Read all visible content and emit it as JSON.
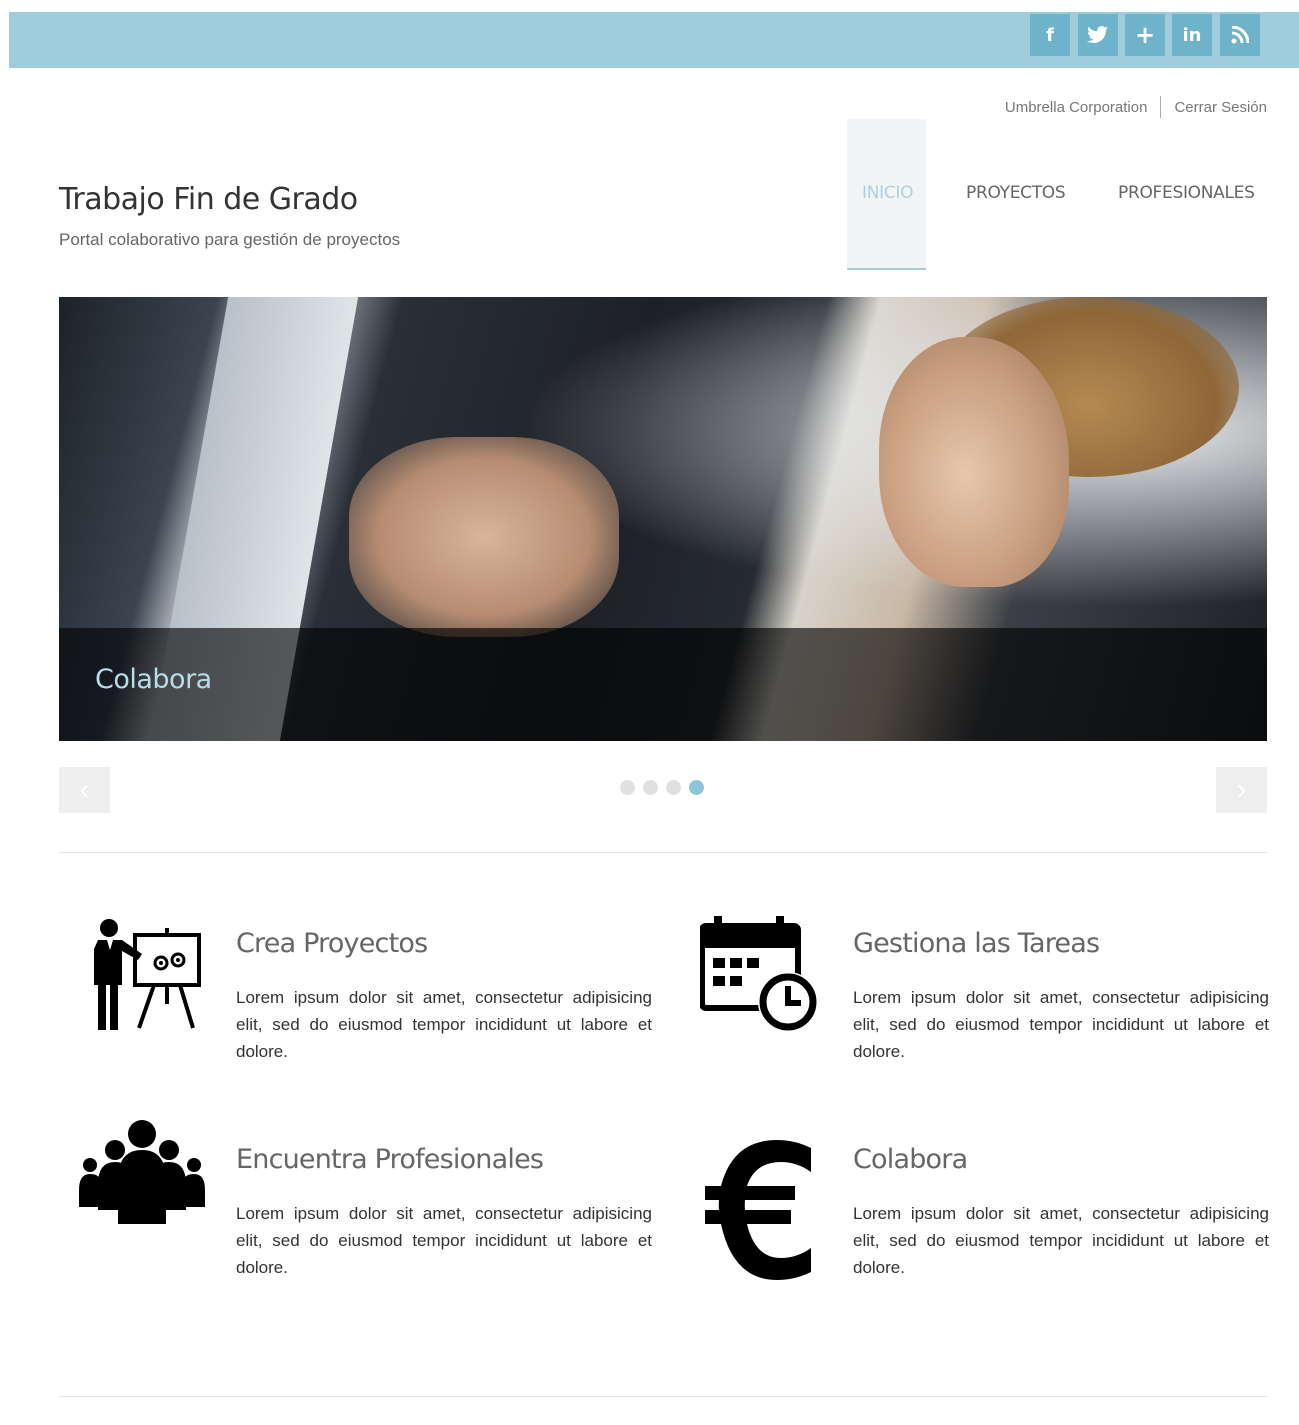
{
  "social": [
    {
      "name": "facebook",
      "glyph": "f"
    },
    {
      "name": "twitter",
      "glyph": "🐦"
    },
    {
      "name": "google-plus",
      "glyph": "+"
    },
    {
      "name": "linkedin",
      "glyph": "in"
    },
    {
      "name": "rss",
      "glyph": "⟆"
    }
  ],
  "account": {
    "company": "Umbrella Corporation",
    "logout": "Cerrar Sesión"
  },
  "brand": {
    "title": "Trabajo Fin de Grado",
    "subtitle": "Portal colaborativo para gestión de proyectos"
  },
  "nav": {
    "items": [
      {
        "label": "INICIO",
        "active": true
      },
      {
        "label": "PROYECTOS",
        "active": false
      },
      {
        "label": "PROFESIONALES",
        "active": false
      }
    ]
  },
  "slider": {
    "caption": "Colabora",
    "prev": "‹",
    "next": "›",
    "slide_count": 4,
    "active_slide": 4
  },
  "features": [
    {
      "icon": "presentation-icon",
      "title": "Crea Proyectos",
      "text": "Lorem ipsum dolor sit amet, consectetur adipisicing elit, sed do eiusmod tempor incididunt ut labore et dolore."
    },
    {
      "icon": "calendar-clock-icon",
      "title": "Gestiona las Tareas",
      "text": "Lorem ipsum dolor sit amet, consectetur adipisicing elit, sed do eiusmod tempor incididunt ut labore et dolore."
    },
    {
      "icon": "group-icon",
      "title": "Encuentra Profesionales",
      "text": "Lorem ipsum dolor sit amet, consectetur adipisicing elit, sed do eiusmod tempor incididunt ut labore et dolore."
    },
    {
      "icon": "euro-icon",
      "title": "Colabora",
      "text": "Lorem ipsum dolor sit amet, consectetur adipisicing elit, sed do eiusmod tempor incididunt ut labore et dolore."
    }
  ],
  "colors": {
    "accent": "#9fcddc",
    "social_button": "#6fb3cb",
    "active_nav": "#a8d3e1"
  }
}
